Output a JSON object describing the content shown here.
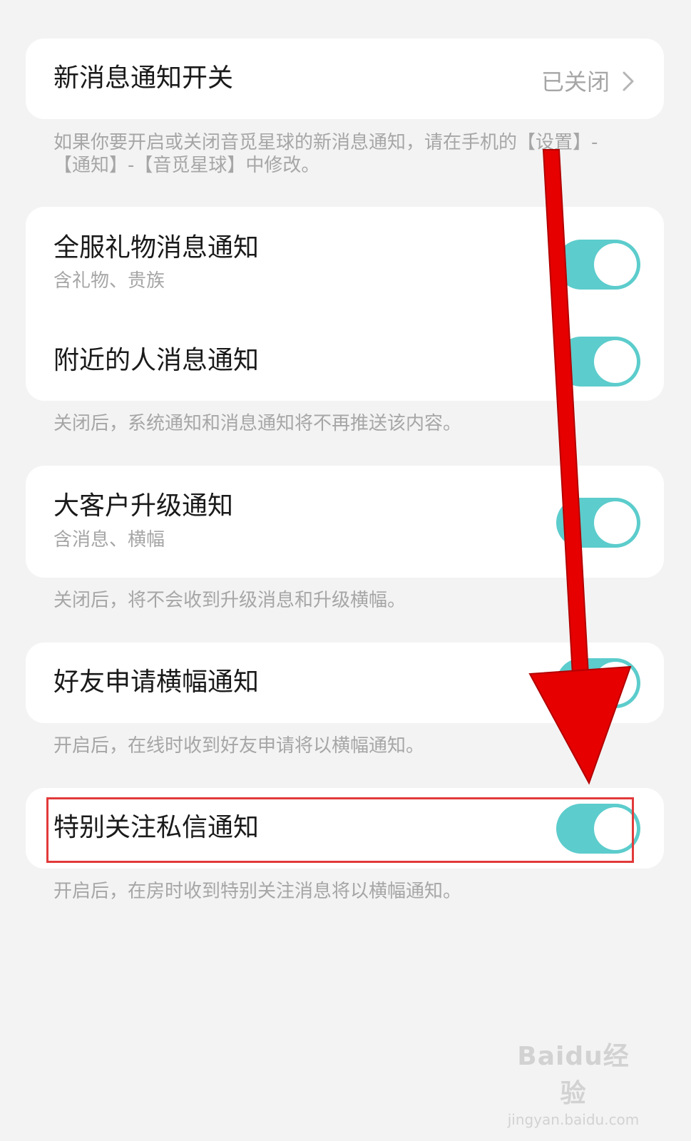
{
  "notification_switch": {
    "title": "新消息通知开关",
    "status": "已关闭",
    "description": "如果你要开启或关闭音觅星球的新消息通知，请在手机的【设置】-【通知】-【音觅星球】中修改。"
  },
  "group_broadcast": {
    "items": [
      {
        "title": "全服礼物消息通知",
        "subtitle": "含礼物、贵族",
        "enabled": true
      },
      {
        "title": "附近的人消息通知",
        "enabled": true
      }
    ],
    "caption": "关闭后，系统通知和消息通知将不再推送该内容。"
  },
  "group_upgrade": {
    "items": [
      {
        "title": "大客户升级通知",
        "subtitle": "含消息、横幅",
        "enabled": true
      }
    ],
    "caption": "关闭后，将不会收到升级消息和升级横幅。"
  },
  "group_friend": {
    "items": [
      {
        "title": "好友申请横幅通知",
        "enabled": true
      }
    ],
    "caption": "开启后，在线时收到好友申请将以横幅通知。"
  },
  "group_special": {
    "items": [
      {
        "title": "特别关注私信通知",
        "enabled": true
      }
    ],
    "caption": "开启后，在房时收到特别关注消息将以横幅通知。"
  },
  "watermark": {
    "logo": "Baidu经验",
    "url": "jingyan.baidu.com"
  },
  "colors": {
    "toggle_on": "#5ccccc",
    "annotation_red": "#e60000",
    "background": "#f3f3f3"
  }
}
